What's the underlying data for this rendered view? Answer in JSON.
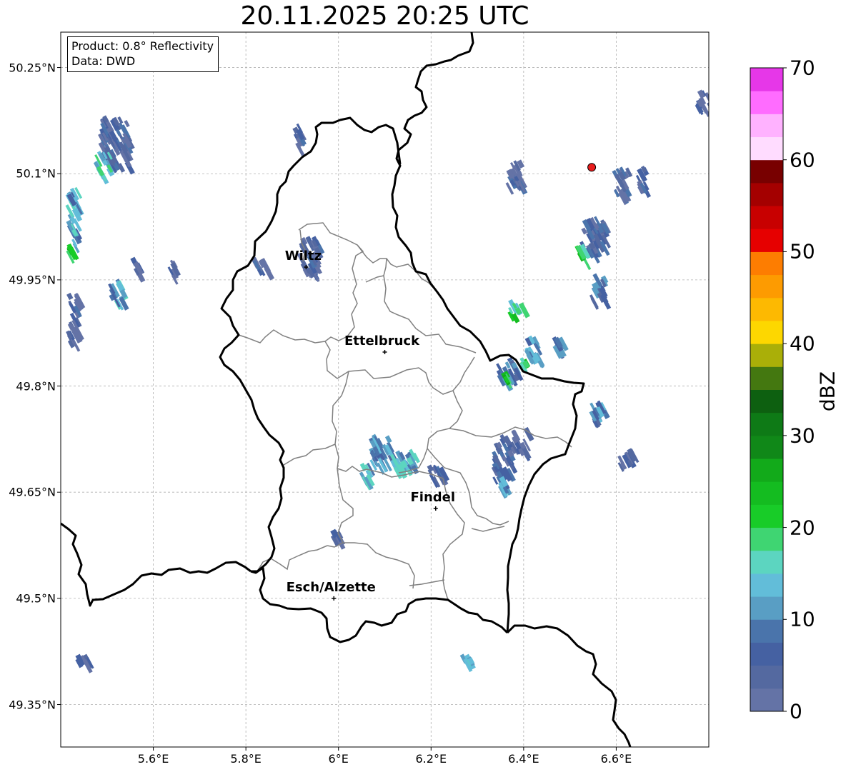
{
  "title": "20.11.2025 20:25 UTC",
  "info": {
    "product": "Product: 0.8° Reflectivity",
    "data": "Data: DWD"
  },
  "lat_ticks": [
    {
      "value": 50.25,
      "label": "50.25°N"
    },
    {
      "value": 50.1,
      "label": "50.1°N"
    },
    {
      "value": 49.95,
      "label": "49.95°N"
    },
    {
      "value": 49.8,
      "label": "49.8°N"
    },
    {
      "value": 49.65,
      "label": "49.65°N"
    },
    {
      "value": 49.5,
      "label": "49.5°N"
    },
    {
      "value": 49.35,
      "label": "49.35°N"
    }
  ],
  "lon_ticks": [
    {
      "value": 5.6,
      "label": "5.6°E"
    },
    {
      "value": 5.8,
      "label": "5.8°E"
    },
    {
      "value": 6.0,
      "label": "6°E"
    },
    {
      "value": 6.2,
      "label": "6.2°E"
    },
    {
      "value": 6.4,
      "label": "6.4°E"
    },
    {
      "value": 6.6,
      "label": "6.6°E"
    }
  ],
  "cities": [
    {
      "name": "Wiltz",
      "lon": 5.93,
      "lat": 49.968
    },
    {
      "name": "Ettelbruck",
      "lon": 6.1,
      "lat": 49.848
    },
    {
      "name": "Findel",
      "lon": 6.21,
      "lat": 49.627
    },
    {
      "name": "Esch/Alzette",
      "lon": 5.99,
      "lat": 49.5
    }
  ],
  "radar_site": {
    "lon": 6.547,
    "lat": 50.109
  },
  "colorbar": {
    "label": "dBZ",
    "min": 0,
    "max": 70,
    "tick_labels": [
      "0",
      "10",
      "20",
      "30",
      "40",
      "50",
      "60",
      "70"
    ],
    "colors": [
      "#6473a6",
      "#5469a0",
      "#4561a2",
      "#4a74ab",
      "#599ec4",
      "#62bdd9",
      "#5cd5c0",
      "#3fd572",
      "#18cc28",
      "#14bc20",
      "#12aa1a",
      "#108818",
      "#0e7a16",
      "#0d6010",
      "#447810",
      "#aaaf08",
      "#fdd700",
      "#fdb901",
      "#fd9b01",
      "#fd7d01",
      "#e60000",
      "#c80000",
      "#a40000",
      "#780000",
      "#ffdcff",
      "#ffb2ff",
      "#ff6cff",
      "#e637e8"
    ]
  },
  "map_extent": {
    "lon_min": 5.4,
    "lon_max": 6.8,
    "lat_min": 49.29,
    "lat_max": 50.3
  },
  "echoes": [
    {
      "lon": 5.48,
      "lat": 50.11,
      "dlon": 0.06,
      "dlat": 0.07,
      "dbz": 6
    },
    {
      "lon": 5.47,
      "lat": 50.1,
      "dlon": 0.03,
      "dlat": 0.03,
      "dbz": 16
    },
    {
      "lon": 5.41,
      "lat": 50.0,
      "dlon": 0.02,
      "dlat": 0.08,
      "dbz": 12
    },
    {
      "lon": 5.41,
      "lat": 49.99,
      "dlon": 0.01,
      "dlat": 0.01,
      "dbz": 24
    },
    {
      "lon": 5.41,
      "lat": 49.86,
      "dlon": 0.02,
      "dlat": 0.07,
      "dbz": 4
    },
    {
      "lon": 5.5,
      "lat": 49.92,
      "dlon": 0.03,
      "dlat": 0.03,
      "dbz": 12
    },
    {
      "lon": 5.55,
      "lat": 49.96,
      "dlon": 0.01,
      "dlat": 0.02,
      "dbz": 4
    },
    {
      "lon": 5.63,
      "lat": 49.95,
      "dlon": 0.01,
      "dlat": 0.03,
      "dbz": 4
    },
    {
      "lon": 5.91,
      "lat": 49.96,
      "dlon": 0.04,
      "dlat": 0.05,
      "dbz": 4
    },
    {
      "lon": 5.81,
      "lat": 49.96,
      "dlon": 0.03,
      "dlat": 0.02,
      "dbz": 4
    },
    {
      "lon": 5.9,
      "lat": 50.14,
      "dlon": 0.02,
      "dlat": 0.03,
      "dbz": 4
    },
    {
      "lon": 6.06,
      "lat": 49.69,
      "dlon": 0.05,
      "dlat": 0.04,
      "dbz": 10
    },
    {
      "lon": 6.11,
      "lat": 49.68,
      "dlon": 0.05,
      "dlat": 0.03,
      "dbz": 14
    },
    {
      "lon": 6.04,
      "lat": 49.67,
      "dlon": 0.02,
      "dlat": 0.02,
      "dbz": 16
    },
    {
      "lon": 6.19,
      "lat": 49.67,
      "dlon": 0.03,
      "dlat": 0.02,
      "dbz": 6
    },
    {
      "lon": 6.33,
      "lat": 49.67,
      "dlon": 0.04,
      "dlat": 0.06,
      "dbz": 6
    },
    {
      "lon": 6.34,
      "lat": 49.65,
      "dlon": 0.02,
      "dlat": 0.02,
      "dbz": 12
    },
    {
      "lon": 6.37,
      "lat": 49.71,
      "dlon": 0.03,
      "dlat": 0.03,
      "dbz": 4
    },
    {
      "lon": 6.52,
      "lat": 49.99,
      "dlon": 0.05,
      "dlat": 0.05,
      "dbz": 6
    },
    {
      "lon": 6.51,
      "lat": 49.98,
      "dlon": 0.02,
      "dlat": 0.02,
      "dbz": 22
    },
    {
      "lon": 6.54,
      "lat": 49.92,
      "dlon": 0.03,
      "dlat": 0.04,
      "dbz": 8
    },
    {
      "lon": 6.365,
      "lat": 49.9,
      "dlon": 0.025,
      "dlat": 0.02,
      "dbz": 20
    },
    {
      "lon": 6.4,
      "lat": 49.84,
      "dlon": 0.03,
      "dlat": 0.03,
      "dbz": 12
    },
    {
      "lon": 6.39,
      "lat": 49.83,
      "dlon": 0.01,
      "dlat": 0.01,
      "dbz": 22
    },
    {
      "lon": 6.46,
      "lat": 49.85,
      "dlon": 0.03,
      "dlat": 0.02,
      "dbz": 10
    },
    {
      "lon": 6.34,
      "lat": 49.81,
      "dlon": 0.04,
      "dlat": 0.03,
      "dbz": 8
    },
    {
      "lon": 6.35,
      "lat": 49.81,
      "dlon": 0.01,
      "dlat": 0.01,
      "dbz": 22
    },
    {
      "lon": 6.54,
      "lat": 49.75,
      "dlon": 0.03,
      "dlat": 0.03,
      "dbz": 10
    },
    {
      "lon": 6.6,
      "lat": 49.69,
      "dlon": 0.03,
      "dlat": 0.02,
      "dbz": 4
    },
    {
      "lon": 6.36,
      "lat": 50.08,
      "dlon": 0.03,
      "dlat": 0.04,
      "dbz": 4
    },
    {
      "lon": 6.59,
      "lat": 50.07,
      "dlon": 0.03,
      "dlat": 0.04,
      "dbz": 6
    },
    {
      "lon": 6.64,
      "lat": 50.08,
      "dlon": 0.02,
      "dlat": 0.03,
      "dbz": 6
    },
    {
      "lon": 6.77,
      "lat": 50.19,
      "dlon": 0.03,
      "dlat": 0.03,
      "dbz": 4
    },
    {
      "lon": 6.25,
      "lat": 49.41,
      "dlon": 0.03,
      "dlat": 0.01,
      "dbz": 16
    },
    {
      "lon": 5.43,
      "lat": 49.41,
      "dlon": 0.03,
      "dlat": 0.01,
      "dbz": 4
    },
    {
      "lon": 5.98,
      "lat": 49.58,
      "dlon": 0.02,
      "dlat": 0.02,
      "dbz": 6
    }
  ]
}
